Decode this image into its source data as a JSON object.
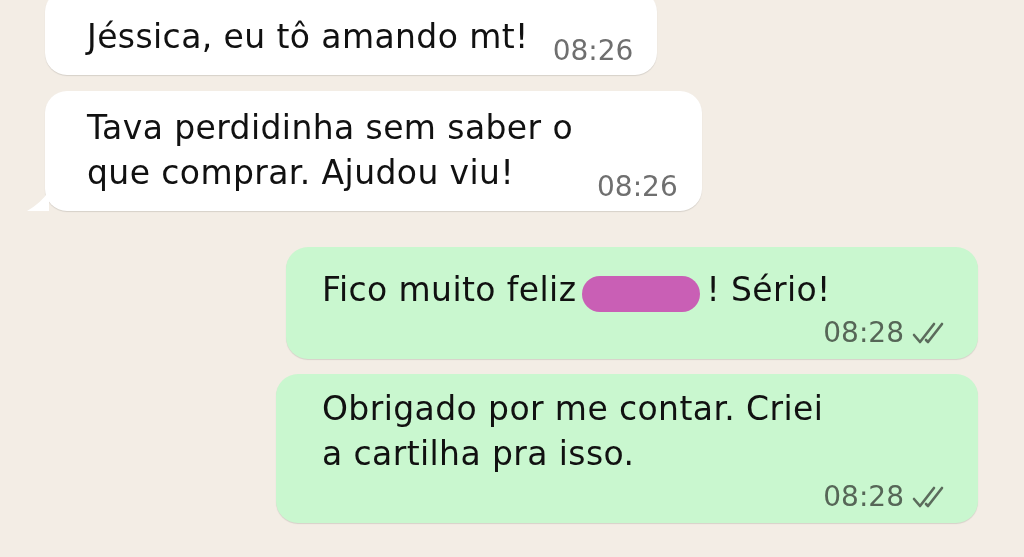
{
  "messages": [
    {
      "outgoing": false,
      "tail": false,
      "parts": [
        {
          "kind": "text",
          "text": "Jéssica, eu tô amando mt!"
        }
      ],
      "time": "08:26"
    },
    {
      "outgoing": false,
      "tail": true,
      "parts": [
        {
          "kind": "text",
          "text": "Tava perdidinha sem saber o\nque comprar. Ajudou viu!"
        }
      ],
      "time": "08:26"
    },
    {
      "outgoing": true,
      "tail": false,
      "parts": [
        {
          "kind": "text",
          "text": "Fico muito feliz"
        },
        {
          "kind": "redaction",
          "color": "#c95fb5"
        },
        {
          "kind": "text",
          "text": "! Sério!"
        }
      ],
      "time": "08:28",
      "read": false
    },
    {
      "outgoing": true,
      "tail": false,
      "parts": [
        {
          "kind": "text",
          "text": "Obrigado por me contar. Criei\na cartilha pra isso."
        }
      ],
      "time": "08:28",
      "read": false
    }
  ]
}
